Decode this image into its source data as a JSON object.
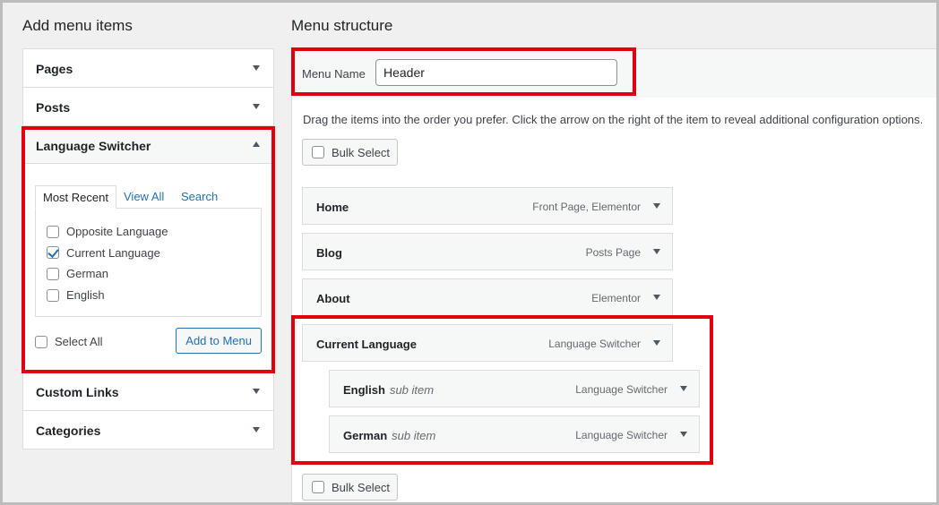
{
  "left": {
    "title": "Add menu items",
    "accordion": [
      {
        "label": "Pages"
      },
      {
        "label": "Posts"
      },
      {
        "label": "Language Switcher"
      },
      {
        "label": "Custom Links"
      },
      {
        "label": "Categories"
      }
    ],
    "tabs": {
      "most_recent": "Most Recent",
      "view_all": "View All",
      "search": "Search"
    },
    "options": [
      {
        "label": "Opposite Language",
        "checked": false
      },
      {
        "label": "Current Language",
        "checked": true
      },
      {
        "label": "German",
        "checked": false
      },
      {
        "label": "English",
        "checked": false
      }
    ],
    "select_all": "Select All",
    "add_to_menu": "Add to Menu"
  },
  "right": {
    "title": "Menu structure",
    "menu_name_label": "Menu Name",
    "menu_name_value": "Header",
    "instructions": "Drag the items into the order you prefer. Click the arrow on the right of the item to reveal additional configuration options.",
    "bulk_select": "Bulk Select",
    "items": [
      {
        "title": "Home",
        "sub": "",
        "type": "Front Page, Elementor"
      },
      {
        "title": "Blog",
        "sub": "",
        "type": "Posts Page"
      },
      {
        "title": "About",
        "sub": "",
        "type": "Elementor"
      },
      {
        "title": "Current Language",
        "sub": "",
        "type": "Language Switcher"
      },
      {
        "title": "English",
        "sub": "sub item",
        "type": "Language Switcher"
      },
      {
        "title": "German",
        "sub": "sub item",
        "type": "Language Switcher"
      }
    ]
  },
  "colors": {
    "highlight": "#e0000f",
    "link": "#2271b1",
    "border": "#dcdcde"
  },
  "icons": {
    "collapsed": "arrow-down-icon",
    "expanded": "arrow-up-icon",
    "checked": "checkmark-icon"
  }
}
